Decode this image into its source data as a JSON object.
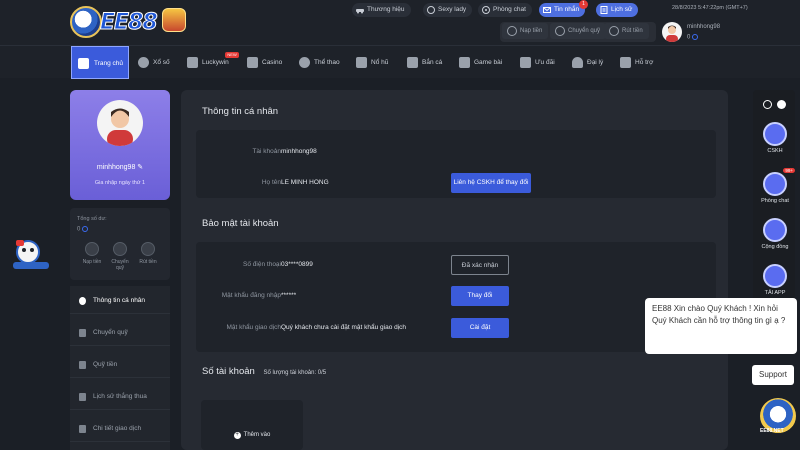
{
  "header": {
    "logo_text": "EE88",
    "pills": [
      "Thương hiệu",
      "Sexy lady",
      "Phòng chat",
      "Tin nhắn",
      "Lịch sử"
    ],
    "message_badge": "1",
    "datetime": "28/8/2023 5:47:22pm   (GMT+7)",
    "wallet_buttons": [
      "Nạp tiền",
      "Chuyển quỹ",
      "Rút tiền"
    ],
    "username": "minhhong98",
    "balance": "0"
  },
  "nav": {
    "items": [
      "Trang chủ",
      "Xổ số",
      "Luckywin",
      "Casino",
      "Thể thao",
      "Nổ hũ",
      "Bắn cá",
      "Game bài",
      "Ưu đãi",
      "Đại lý",
      "Hỗ trợ"
    ],
    "new_tag": "NEW"
  },
  "sidebar": {
    "username": "minhhong98",
    "joined": "Gia nhập ngày thứ 1",
    "balance_label": "Tổng số dư:",
    "balance": "0",
    "wallet_actions": [
      "Nạp tiền",
      "Chuyển quỹ",
      "Rút tiền"
    ],
    "menu": [
      "Thông tin cá nhân",
      "Chuyển quỹ",
      "Quỹ tiền",
      "Lịch sử thắng thua",
      "Chi tiết giao dịch"
    ]
  },
  "main": {
    "personal": {
      "title": "Thông tin cá nhân",
      "account_label": "Tài khoản",
      "account_value": "minhhong98",
      "name_label": "Họ tên",
      "name_value": "LE MINH HONG",
      "contact_btn": "Liên hệ CSKH để thay đổi"
    },
    "security": {
      "title": "Bảo mật tài khoản",
      "phone_label": "Số điện thoại",
      "phone_value": "03****0899",
      "phone_btn": "Đã xác nhận",
      "login_pw_label": "Mật khẩu đăng nhập",
      "login_pw_value": "******",
      "login_pw_btn": "Thay đổi",
      "trans_pw_label": "Mật khẩu giao dịch",
      "trans_pw_value": "Quý khách chưa cài đặt mật khẩu giao dịch",
      "trans_pw_btn": "Cài đặt"
    },
    "accounts": {
      "title": "Số tài khoản",
      "count_label": "Số lượng tài khoản:",
      "count_value": "0/5",
      "add_label": "Thêm vào"
    }
  },
  "rightbar": {
    "items": [
      "CSKH",
      "Phòng chat",
      "Cộng đồng",
      "TẢI APP"
    ],
    "chat_badge": "99+"
  },
  "chat": {
    "message": "EE88 Xin chào Quý Khách ! Xin hỏi Quý Khách cần hỗ trợ thông tin gì ạ ?",
    "support_label": "Support"
  },
  "bottom_logo_text": "EE88.NET",
  "colors": {
    "accent": "#3b5bdb",
    "background": "#1b1f26",
    "panel": "#262a32",
    "profile_card": "#7b6fe0",
    "badge": "#e53935"
  }
}
